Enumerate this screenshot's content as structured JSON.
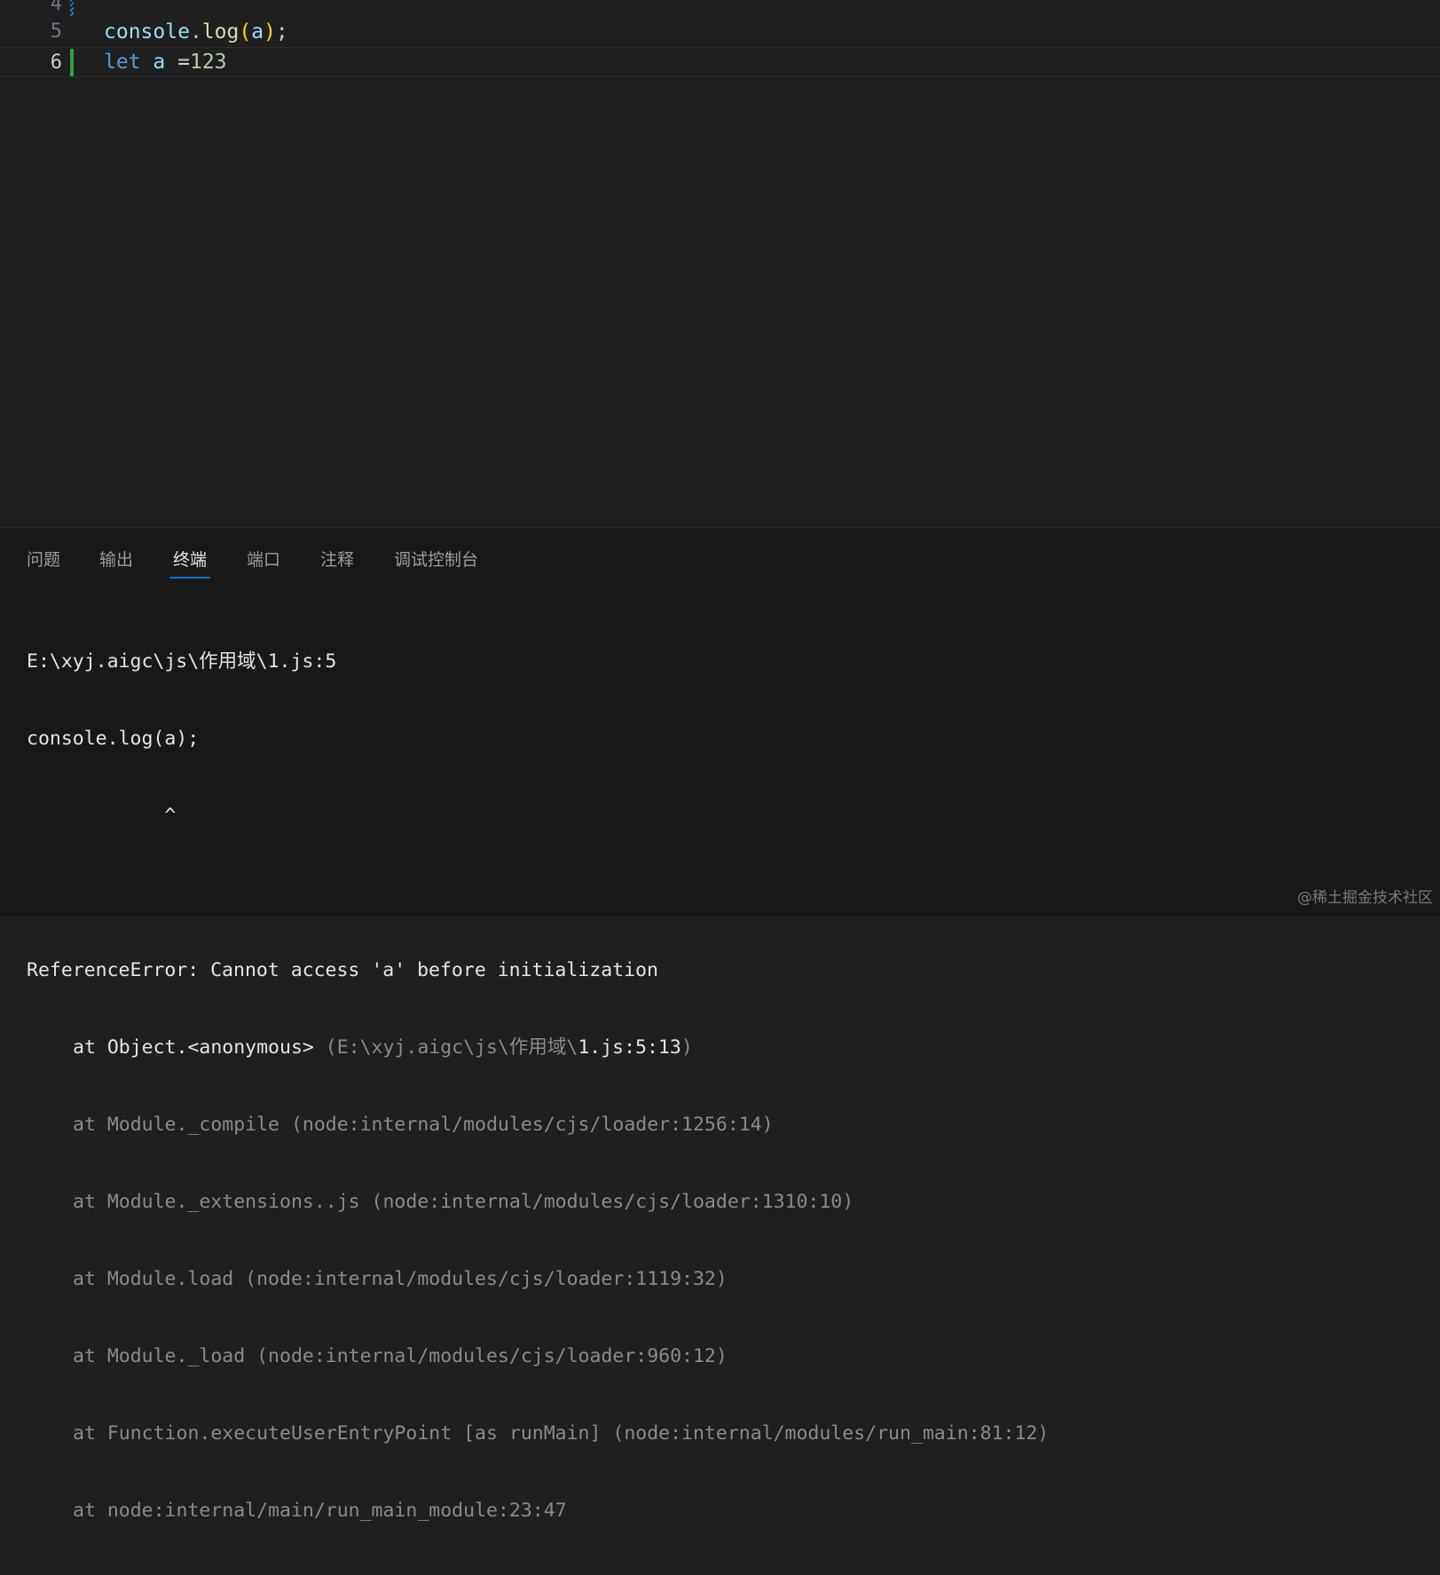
{
  "editor": {
    "lines": [
      {
        "number": "4",
        "text": ""
      },
      {
        "number": "5",
        "tokens": [
          "console",
          ".",
          "log",
          "(",
          "a",
          ")",
          ";"
        ]
      },
      {
        "number": "6",
        "tokens": [
          "let",
          " ",
          "a",
          " =",
          "123"
        ]
      }
    ]
  },
  "panel": {
    "tabs": [
      "问题",
      "输出",
      "终端",
      "端口",
      "注释",
      "调试控制台"
    ],
    "active_tab": "终端"
  },
  "terminal": {
    "lines": [
      "E:\\xyj.aigc\\js\\作用域\\1.js:5",
      "console.log(a);",
      "            ^",
      "",
      "ReferenceError: Cannot access 'a' before initialization",
      "at Object.<anonymous>",
      " (E:\\xyj.aigc\\js\\作用域\\",
      "1.js:5:13",
      ")",
      "at Module._compile (node:internal/modules/cjs/loader:1256:14)",
      "at Module._extensions..js (node:internal/modules/cjs/loader:1310:10)",
      "at Module.load (node:internal/modules/cjs/loader:1119:32)",
      "at Module._load (node:internal/modules/cjs/loader:960:12)",
      "at Function.executeUserEntryPoint [as runMain] (node:internal/modules/run_main:81:12)",
      "at node:internal/main/run_main_module:23:47"
    ]
  },
  "watermark": "@稀土掘金技术社区"
}
